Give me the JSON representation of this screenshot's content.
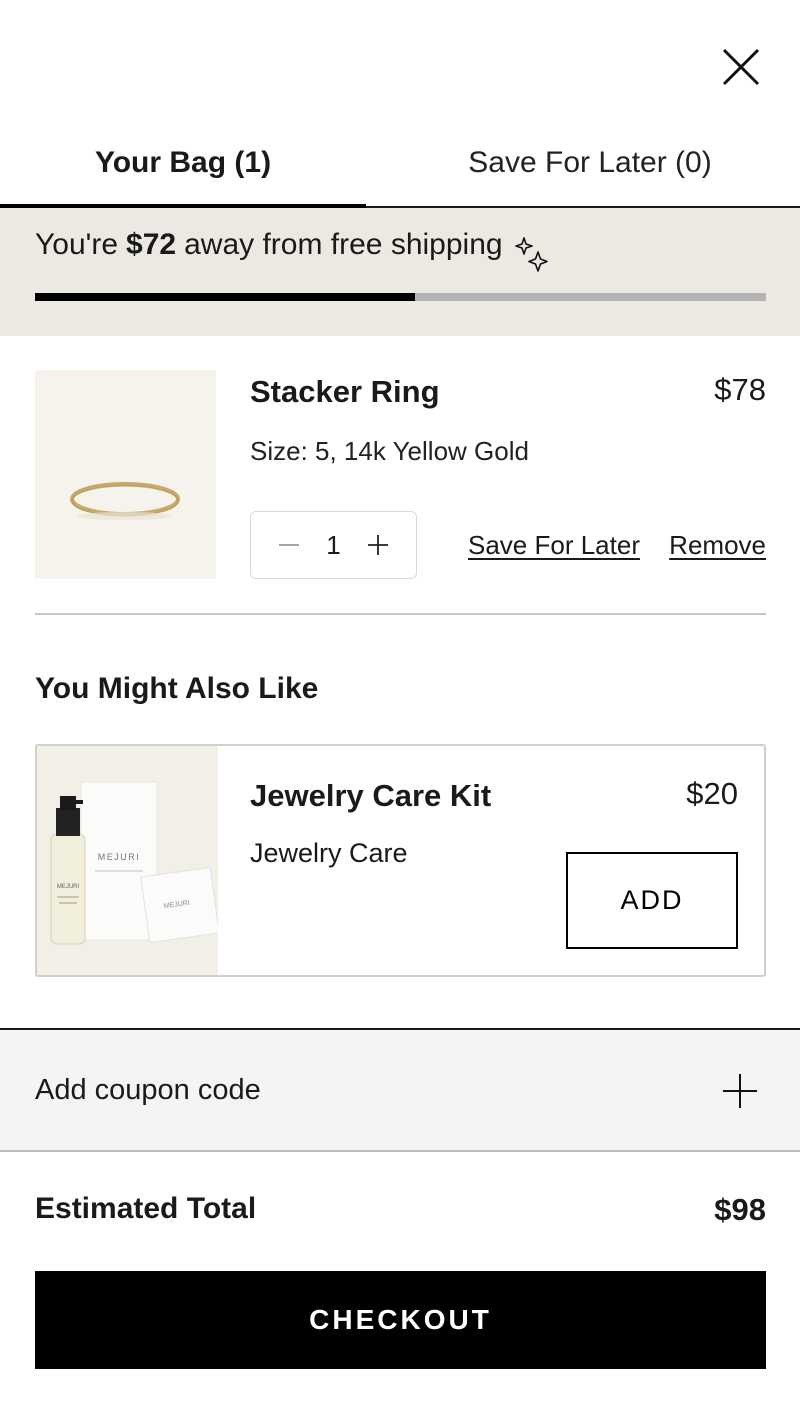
{
  "header": {
    "close_icon": "close-icon"
  },
  "tabs": [
    {
      "label": "Your Bag (1)",
      "active": true
    },
    {
      "label": "Save For Later (0)",
      "active": false
    }
  ],
  "shipping": {
    "prefix": "You're",
    "amount": "$72",
    "suffix": "away from free shipping",
    "icon": "sparkle-icon",
    "progress": 0.52
  },
  "cart_item": {
    "name": "Stacker Ring",
    "price": "$78",
    "variant": "Size: 5, 14k Yellow Gold",
    "quantity": "1",
    "save_for_later_label": "Save For Later",
    "remove_label": "Remove"
  },
  "recommendations": {
    "title": "You Might Also Like",
    "items": [
      {
        "name": "Jewelry Care Kit",
        "category": "Jewelry Care",
        "price": "$20",
        "add_label": "ADD",
        "image_brand": "MEJURI"
      }
    ]
  },
  "coupon": {
    "label": "Add coupon code",
    "icon": "plus-icon"
  },
  "summary": {
    "total_label": "Estimated Total",
    "total_value": "$98"
  },
  "checkout": {
    "label": "CHECKOUT"
  },
  "colors": {
    "shipping_bg": "#ebe9e2",
    "progress_fill": "#000000",
    "progress_track": "#b3b3b3",
    "checkout_bg": "#000000"
  }
}
